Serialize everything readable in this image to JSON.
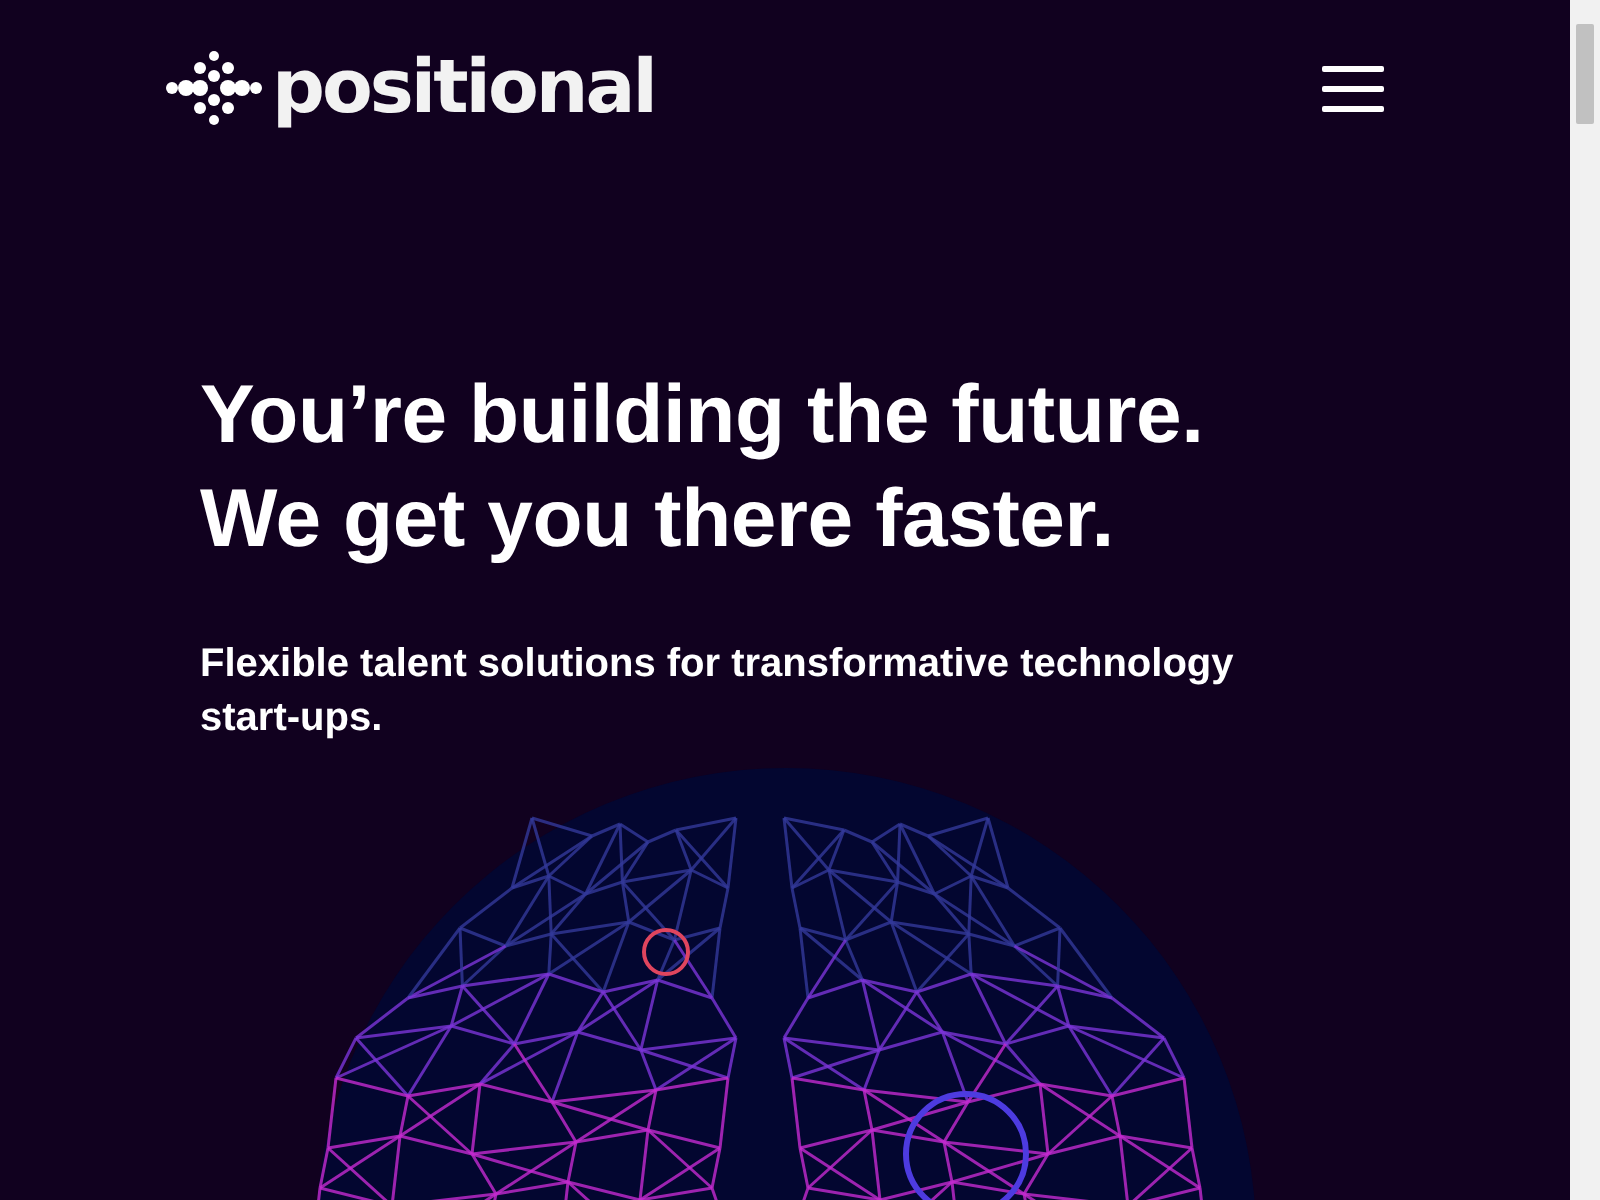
{
  "header": {
    "logo_text": "positional"
  },
  "hero": {
    "headline_lines": [
      "You’re building the future.",
      "We get you there faster."
    ],
    "subtitle": "Flexible talent solutions for transformative technology start-ups."
  }
}
